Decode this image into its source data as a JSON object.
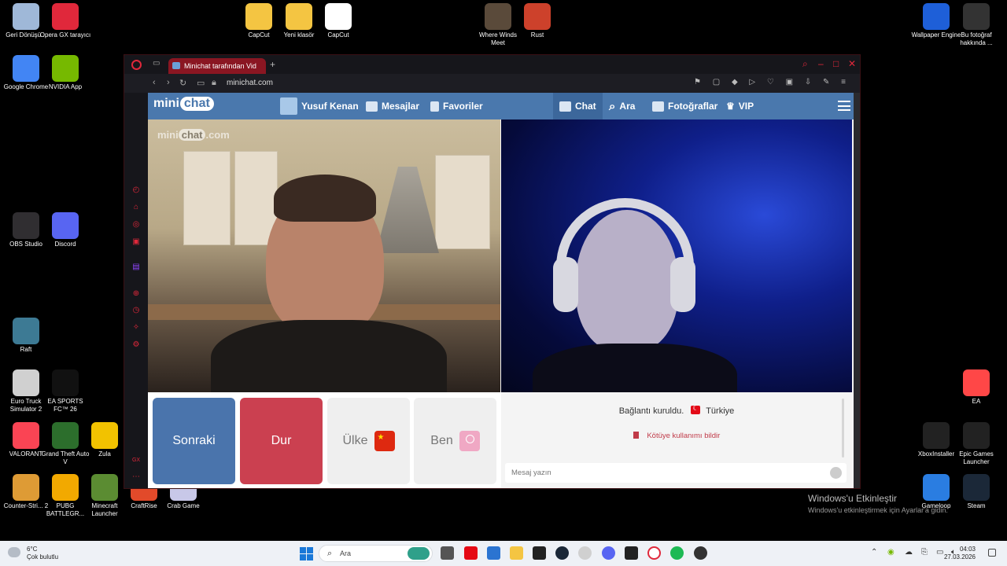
{
  "desktop": {
    "icons_left": [
      {
        "label": "Geri Dönüşü...",
        "icon": "recycle-bin-icon",
        "color": "#9fb8d8"
      },
      {
        "label": "Opera GX tarayıcı",
        "icon": "opera-gx-icon",
        "color": "#e0283b"
      },
      {
        "label": "Google Chrome",
        "icon": "chrome-icon",
        "color": "#4285f4"
      },
      {
        "label": "NVIDIA App",
        "icon": "nvidia-icon",
        "color": "#76b900"
      },
      {
        "label": "OBS Studio",
        "icon": "obs-icon",
        "color": "#302e31"
      },
      {
        "label": "Discord",
        "icon": "discord-icon",
        "color": "#5865f2"
      },
      {
        "label": "Raft",
        "icon": "raft-icon",
        "color": "#3d7a94"
      },
      {
        "label": "Euro Truck Simulator 2",
        "icon": "ets2-icon",
        "color": "#d0d0d0"
      },
      {
        "label": "EA SPORTS FC™ 26",
        "icon": "easports-icon",
        "color": "#111111"
      },
      {
        "label": "VALORANT",
        "icon": "valorant-icon",
        "color": "#fa4454"
      },
      {
        "label": "Grand Theft Auto V",
        "icon": "gta-icon",
        "color": "#2c6e2c"
      },
      {
        "label": "Zula",
        "icon": "zula-icon",
        "color": "#f2c200"
      },
      {
        "label": "Counter-Stri... 2",
        "icon": "cs2-icon",
        "color": "#de9b35"
      },
      {
        "label": "PUBG BATTLEGR...",
        "icon": "pubg-icon",
        "color": "#f2a900"
      },
      {
        "label": "Minecraft Launcher",
        "icon": "minecraft-icon",
        "color": "#5b8c32"
      },
      {
        "label": "CraftRise",
        "icon": "craftrise-icon",
        "color": "#e24a2a"
      },
      {
        "label": "Crab Game",
        "icon": "crabgame-icon",
        "color": "#c8c8e8"
      }
    ],
    "icons_top": [
      {
        "label": "CapCut",
        "icon": "folder-icon",
        "color": "#f4c542"
      },
      {
        "label": "Yeni klasör",
        "icon": "folder-icon",
        "color": "#f4c542"
      },
      {
        "label": "CapCut",
        "icon": "capcut-icon",
        "color": "#ffffff"
      },
      {
        "label": "Where Winds Meet",
        "icon": "wherewinds-icon",
        "color": "#5a4a3a"
      },
      {
        "label": "Rust",
        "icon": "rust-icon",
        "color": "#cd412b"
      }
    ],
    "icons_right": [
      {
        "label": "Wallpaper Engine",
        "icon": "wallpaper-engine-icon",
        "color": "#1e5fd8"
      },
      {
        "label": "Bu fotoğraf hakkında ...",
        "icon": "info-icon",
        "color": "#333333"
      },
      {
        "label": "EA",
        "icon": "ea-icon",
        "color": "#ff4747"
      },
      {
        "label": "XboxInstaller",
        "icon": "xbox-icon",
        "color": "#222222"
      },
      {
        "label": "Epic Games Launcher",
        "icon": "epic-icon",
        "color": "#222222"
      },
      {
        "label": "Gameloop",
        "icon": "gameloop-icon",
        "color": "#2a7de1"
      },
      {
        "label": "Steam",
        "icon": "steam-icon",
        "color": "#1b2838"
      }
    ],
    "activation": {
      "title": "Windows'u Etkinleştir",
      "subtitle": "Windows'u etkinleştirmek için Ayarlar'a gidin."
    }
  },
  "browser": {
    "tab_title": "Minichat tarafından Vid",
    "url": "minichat.com",
    "accent": "#e0283b"
  },
  "minichat": {
    "logo_mini": "mini",
    "logo_chat": "chat",
    "nav": {
      "user": "Yusuf Kenan",
      "messages": "Mesajlar",
      "favorites": "Favoriler",
      "chat": "Chat",
      "search": "Ara",
      "photos": "Fotoğraflar",
      "vip": "VIP"
    },
    "watermark_mini": "mini",
    "watermark_chat": "chat",
    "watermark_domain": ".com",
    "buttons": {
      "next": "Sonraki",
      "stop": "Dur",
      "country": "Ülke",
      "me": "Ben"
    },
    "status": {
      "connected": "Bağlantı kuruldu.",
      "country": "Türkiye",
      "report": "Kötüye kullanımı bildir"
    },
    "message_placeholder": "Mesaj yazın",
    "colors": {
      "nav": "#4a78ad",
      "next": "#4a74ac",
      "stop": "#cb4050"
    }
  },
  "taskbar": {
    "weather_temp": "6°C",
    "weather_desc": "Çok bulutlu",
    "search_placeholder": "Ara",
    "time": "04:03",
    "date": "27.03.2026"
  }
}
